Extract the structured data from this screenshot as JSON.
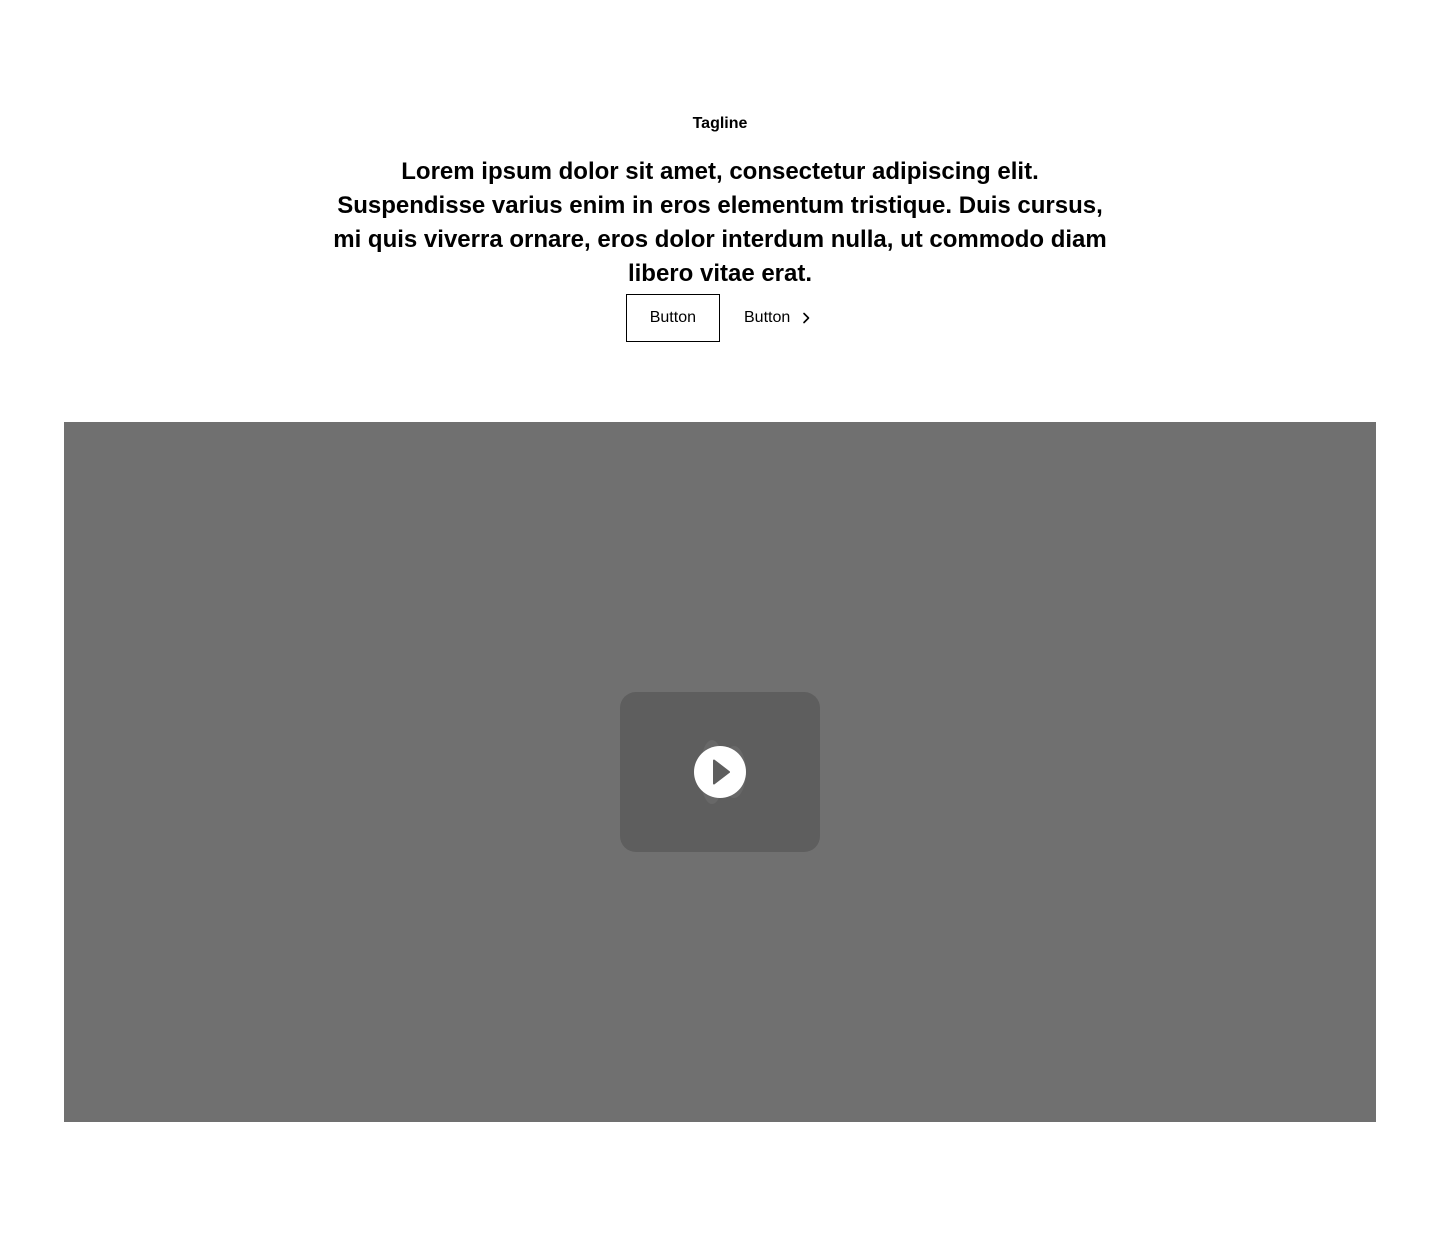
{
  "header": {
    "tagline": "Tagline",
    "headline": "Lorem ipsum dolor sit amet, consectetur adipiscing elit. Suspendisse varius enim in eros elementum tristique. Duis cursus, mi quis viverra ornare, eros dolor interdum nulla, ut commodo diam libero vitae erat."
  },
  "actions": {
    "primary_label": "Button",
    "secondary_label": "Button",
    "secondary_icon": "chevron-right-icon"
  },
  "video": {
    "icon": "play-icon",
    "colors": {
      "background": "#707070",
      "panel": "#5e5e5e",
      "play": "#ffffff"
    }
  }
}
